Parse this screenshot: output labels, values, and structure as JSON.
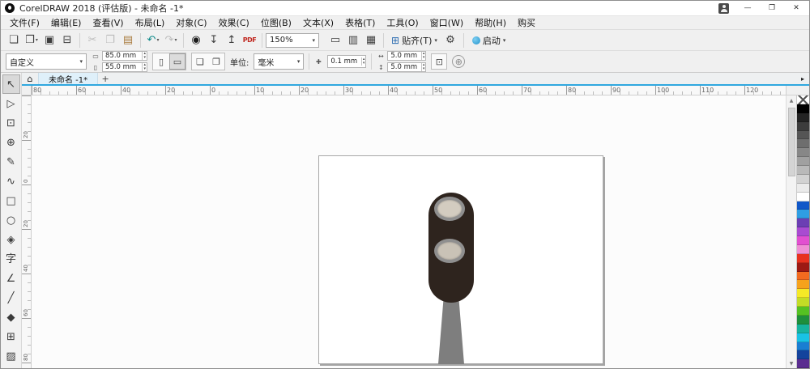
{
  "titlebar": {
    "title": "CorelDRAW 2018 (评估版) - 未命名 -1*",
    "minimize_icon": "—",
    "maximize_icon": "❐",
    "close_icon": "✕"
  },
  "menubar": {
    "items": [
      {
        "label": "文件(F)"
      },
      {
        "label": "编辑(E)"
      },
      {
        "label": "查看(V)"
      },
      {
        "label": "布局(L)"
      },
      {
        "label": "对象(C)"
      },
      {
        "label": "效果(C)"
      },
      {
        "label": "位图(B)"
      },
      {
        "label": "文本(X)"
      },
      {
        "label": "表格(T)"
      },
      {
        "label": "工具(O)"
      },
      {
        "label": "窗口(W)"
      },
      {
        "label": "帮助(H)"
      },
      {
        "label": "购买"
      }
    ]
  },
  "toolbar": {
    "main_buttons": [
      {
        "name": "new-document-button",
        "glyph": "❏"
      },
      {
        "name": "open-button",
        "glyph": "❒",
        "dropdown": true
      },
      {
        "name": "save-button",
        "glyph": "▣"
      },
      {
        "name": "print-button",
        "glyph": "⊟",
        "group_end": true
      },
      {
        "name": "cut-button",
        "glyph": "✂",
        "disabled": true
      },
      {
        "name": "copy-button",
        "glyph": "❐",
        "disabled": true
      },
      {
        "name": "paste-button",
        "glyph": "▤",
        "color": "#a97b3e",
        "group_end": true
      },
      {
        "name": "undo-button",
        "glyph": "↶",
        "color": "#0d8a8a",
        "dropdown": true
      },
      {
        "name": "redo-button",
        "glyph": "↷",
        "disabled": true,
        "dropdown": true,
        "group_end": true
      },
      {
        "name": "search-content-button",
        "glyph": "◉",
        "color": "#1b1b1b"
      },
      {
        "name": "import-button",
        "glyph": "↧"
      },
      {
        "name": "export-button",
        "glyph": "↥"
      },
      {
        "name": "pdf-button",
        "glyph": "PDF",
        "pdf": true,
        "color": "#c0271f",
        "group_end": true
      }
    ],
    "zoom_value": "150%",
    "view_buttons": [
      {
        "name": "fullscreen-preview-button",
        "glyph": "▭"
      },
      {
        "name": "show-rulers-button",
        "glyph": "▥"
      },
      {
        "name": "show-grid-button",
        "glyph": "▦",
        "group_end": true
      }
    ],
    "snap": {
      "icon": "⊞",
      "label": "贴齐(T)"
    },
    "options_icon": "⚙",
    "launch_label": "启动"
  },
  "propbar": {
    "preset": "自定义",
    "width_icon": "▭",
    "width_value": "85.0 mm",
    "height_icon": "▯",
    "height_value": "55.0 mm",
    "portrait_icon": "▯",
    "landscape_icon": "▭",
    "all_pages_icon": "❏",
    "current_page_icon": "❐",
    "units_label": "单位:",
    "units_value": "毫米",
    "nudge_icon": "✚",
    "nudge_value": "0.1 mm",
    "dup_x_icon": "↔",
    "dup_x_value": "5.0 mm",
    "dup_y_icon": "↕",
    "dup_y_value": "5.0 mm",
    "treat_icon": "⊡",
    "welcome_icon": "⊕"
  },
  "tabbar": {
    "home_icon": "⌂",
    "tab_label": "未命名 -1*",
    "add_label": "+",
    "scroll_icon": "▸"
  },
  "rulers": {
    "h_labels": [
      "80",
      "60",
      "40",
      "20",
      "0",
      "10",
      "20",
      "30",
      "40",
      "50",
      "60",
      "70",
      "80",
      "90",
      "100",
      "110",
      "120"
    ],
    "v_labels": [
      "20",
      "0",
      "20",
      "40",
      "60",
      "80"
    ]
  },
  "toolbox": {
    "tools": [
      {
        "name": "pick-tool",
        "glyph": "↖",
        "selected": true
      },
      {
        "name": "shape-tool",
        "glyph": "▷"
      },
      {
        "name": "crop-tool",
        "glyph": "⊡"
      },
      {
        "name": "zoom-tool",
        "glyph": "⊕"
      },
      {
        "name": "freehand-tool",
        "glyph": "✎"
      },
      {
        "name": "artistic-media-tool",
        "glyph": "∿"
      },
      {
        "name": "rectangle-tool",
        "glyph": "□"
      },
      {
        "name": "ellipse-tool",
        "glyph": "○"
      },
      {
        "name": "polygon-tool",
        "glyph": "◈"
      },
      {
        "name": "text-tool",
        "glyph": "字"
      },
      {
        "name": "dimension-tool",
        "glyph": "∠"
      },
      {
        "name": "connector-tool",
        "glyph": "╱"
      },
      {
        "name": "interactive-fill-tool",
        "glyph": "◆"
      },
      {
        "name": "graph-paper-tool",
        "glyph": "⊞"
      },
      {
        "name": "pattern-fill-tool",
        "glyph": "▨"
      }
    ]
  },
  "palette": {
    "colors": [
      "none",
      "#000000",
      "#232323",
      "#3c3c3c",
      "#555555",
      "#6e6e6e",
      "#878787",
      "#a0a0a0",
      "#b9b9b9",
      "#d2d2d2",
      "#ebebeb",
      "#ffffff",
      "#1057c8",
      "#2f9ee3",
      "#6b3fb3",
      "#a94bd1",
      "#e24fd0",
      "#ef8fd4",
      "#e8321f",
      "#9c1a14",
      "#f26a1f",
      "#f6a21c",
      "#f5e927",
      "#c3dc26",
      "#55c122",
      "#1e8f3c",
      "#17b39e",
      "#19c2e5",
      "#1a7ed2",
      "#14439c",
      "#5b2d90"
    ]
  },
  "scrollbar": {
    "up_icon": "▲",
    "down_icon": "▼"
  },
  "ui": {
    "caret": "▾",
    "spin_up": "▴",
    "spin_down": "▾"
  },
  "canvas": {
    "drawing": {
      "body_color": "#2e241e",
      "ring_color": "#8f8f8f",
      "upper_light_color": "#d3ccc0",
      "lower_light_color": "#c9c2b6",
      "stem_color": "#7e7e7e"
    }
  }
}
